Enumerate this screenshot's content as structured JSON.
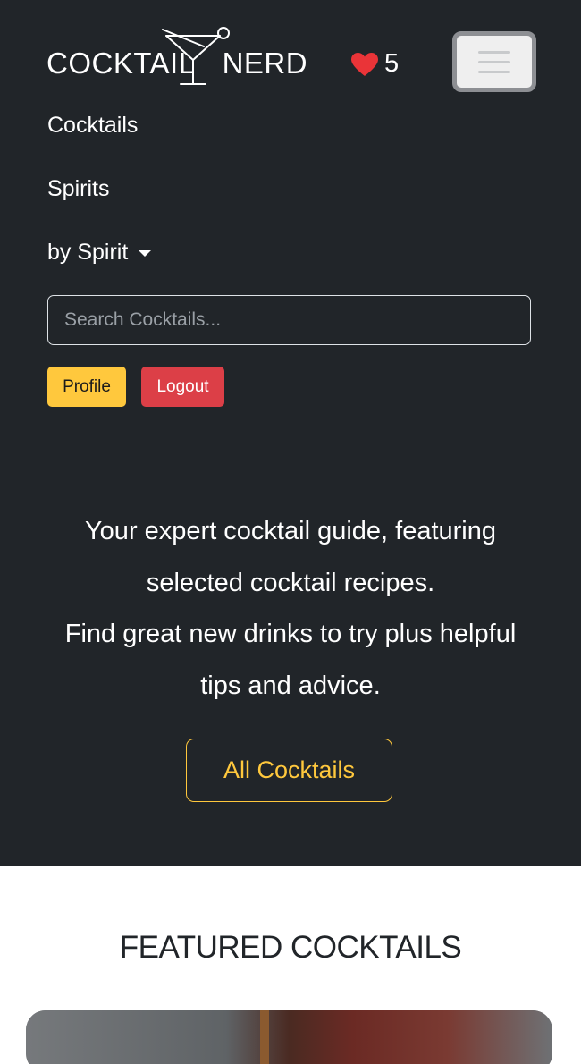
{
  "header": {
    "logo": {
      "left": "COCKTAIL",
      "right": "NERD"
    },
    "favorites_count": "5",
    "colors": {
      "background": "#212529",
      "heart": "#ea3438",
      "accent": "#ffc83d",
      "danger": "#dc3f47"
    }
  },
  "nav": {
    "items": [
      {
        "label": "Cocktails"
      },
      {
        "label": "Spirits"
      },
      {
        "label": "by Spirit"
      }
    ],
    "search": {
      "placeholder": "Search Cocktails...",
      "value": ""
    },
    "profile_label": "Profile",
    "logout_label": "Logout"
  },
  "hero": {
    "line1": "Your expert cocktail guide, featuring",
    "line2": "selected cocktail recipes.",
    "line3": "Find great new drinks to try plus helpful",
    "line4": "tips and advice.",
    "cta_label": "All Cocktails"
  },
  "featured": {
    "heading": "FEATURED COCKTAILS"
  },
  "icons": {
    "logo": "martini-glass-icon",
    "favorites": "heart-icon",
    "menu": "hamburger-menu-icon",
    "dropdown": "caret-down-icon"
  }
}
